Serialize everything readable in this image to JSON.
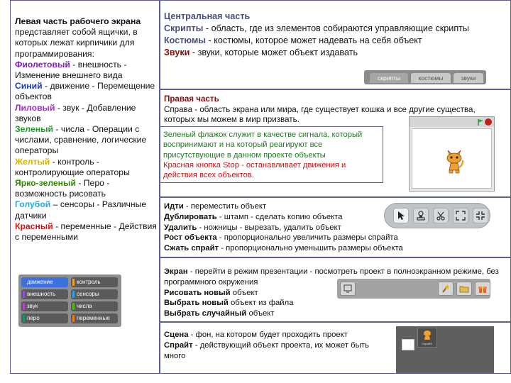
{
  "left": {
    "intro_bold": "Левая часть рабочего экрана",
    "intro_rest": " представляет собой ящички, в которых лежат кирпичики для программирования:",
    "items": [
      {
        "name": " Фиолетовый",
        "desc": " - внешность - Изменение внешнего вида"
      },
      {
        "name": "Синий",
        "desc": " - движение - Перемещение объектов"
      },
      {
        "name": "Лиловый",
        "desc": " - звук - Добавление звуков"
      },
      {
        "name": "Зеленый",
        "desc": " - числа - Операции с числами, сравнение, логические операторы"
      },
      {
        "name": "Желтый",
        "desc": " - контроль - контролирующие операторы"
      },
      {
        "name": "Ярко-зеленый",
        "desc": " - Перо - возможность рисовать"
      },
      {
        "name": "Голубой",
        "desc": " – сенсоры - Различные датчики"
      },
      {
        "name": "Красный",
        "desc": " - переменные - Действия с переменными"
      }
    ],
    "palette": [
      {
        "label": "движение",
        "color": "#4a6cd4"
      },
      {
        "label": "контроль",
        "color": "#e6a822"
      },
      {
        "label": "внешность",
        "color": "#8a55d7"
      },
      {
        "label": "сенсоры",
        "color": "#2ca5e2"
      },
      {
        "label": "звук",
        "color": "#bb42c3"
      },
      {
        "label": "числа",
        "color": "#5cb712"
      },
      {
        "label": "перо",
        "color": "#0e9a6c"
      },
      {
        "label": "переменные",
        "color": "#ee7d16"
      }
    ]
  },
  "center": {
    "title": "Центральная часть",
    "line1_name": " Скрипты",
    "line1_desc": " - область, где из элементов собираются управляющие скрипты",
    "line2_name": "Костюмы",
    "line2_desc": " - костюмы, которое может надевать на себя объект",
    "line3_name": "Звуки",
    "line3_desc": " - звуки, которые может объект издавать",
    "tabs": [
      "скрипты",
      "костюмы",
      "звуки"
    ]
  },
  "right": {
    "title": "Правая часть",
    "desc": "Справа - область экрана или мира, где существует кошка и все другие существа, которых мы можем в мир призвать.",
    "flag_text": "Зеленый флажок служит в качестве сигнала, который воспринимают и на который реагируют все присутствующие в данном проекте объекты",
    "stop_text": "Красная кнопка Stop - останавливает движения и действия всех объектов."
  },
  "tools": {
    "lines": [
      {
        "name": "Идти",
        "desc": " - переместить объект"
      },
      {
        "name": "Дублировать",
        "desc": " - штамп - сделать копию объекта"
      },
      {
        "name": "Удалить",
        "desc": " - ножницы - вырезать, удалить объект"
      },
      {
        "name": "Рост объекта",
        "desc": " - пропорционально увеличить размеры спрайта"
      },
      {
        "name": "Сжать спрайт",
        "desc": " - пропорционально уменьшить размеры объекта"
      }
    ]
  },
  "screen": {
    "line1_name": "Экран",
    "line1_desc": " - перейти в режим презентации - посмотреть проект в полноэкранном режиме, без программного окружения",
    "line2": "Рисовать новый",
    "line2_tail": " объект",
    "line3": "Выбрать новый",
    "line3_tail": " объект из файла",
    "line4": "Выбрать случайный",
    "line4_tail": " объект"
  },
  "stagepanel": {
    "line1_name": "Сцена",
    "line1_desc": " - фон, на котором будет проходить проект",
    "line2_name": "Спрайт",
    "line2_desc": " - действующий объект проекта, их может быть много",
    "sprite_caption": "Спрайт1"
  }
}
